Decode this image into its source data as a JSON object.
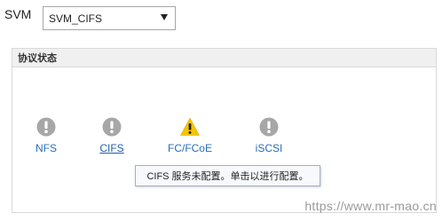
{
  "svm": {
    "label": "SVM",
    "selected": "SVM_CIFS"
  },
  "panel": {
    "title": "协议状态",
    "protocols": [
      {
        "label": "NFS",
        "status_icon": "info-circle-icon",
        "status": "neutral"
      },
      {
        "label": "CIFS",
        "status_icon": "info-circle-icon",
        "status": "not-configured",
        "is_link": true
      },
      {
        "label": "FC/FCoE",
        "status_icon": "warning-triangle-icon",
        "status": "warning"
      },
      {
        "label": "iSCSI",
        "status_icon": "info-circle-icon",
        "status": "neutral"
      }
    ]
  },
  "tooltip": {
    "text": "CIFS 服务未配置。单击以进行配置。"
  },
  "watermark": "https://www.mr-mao.cn",
  "colors": {
    "info_icon": "#a7a7a7",
    "warning_icon": "#f5c400",
    "link": "#1f5fa8",
    "label": "#2b6fb6"
  }
}
